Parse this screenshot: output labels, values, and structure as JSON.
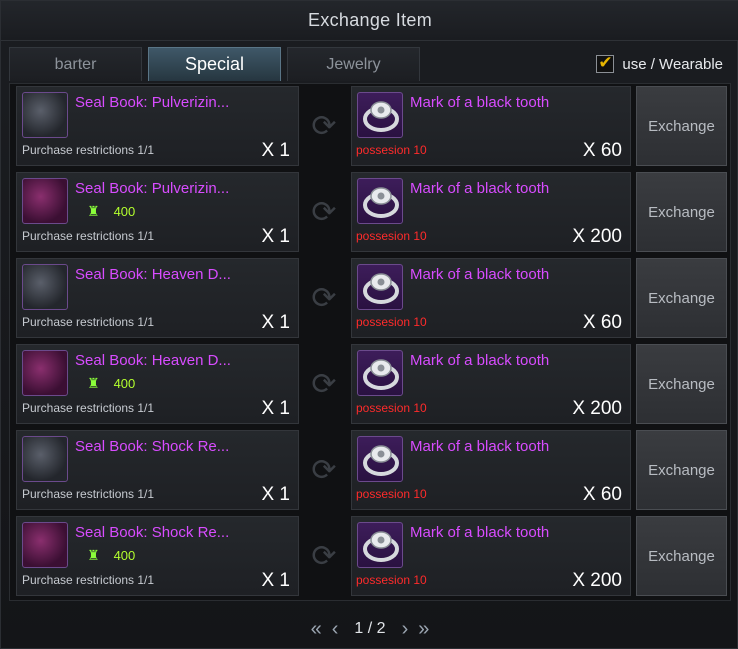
{
  "window": {
    "title": "Exchange Item"
  },
  "tabs": [
    {
      "label": "barter",
      "active": false
    },
    {
      "label": "Special",
      "active": true
    },
    {
      "label": "Jewelry",
      "active": false
    }
  ],
  "filter": {
    "label": "use / Wearable",
    "checked": true
  },
  "exchange_label": "Exchange",
  "rows": [
    {
      "item_name": "Seal Book: Pulverizin...",
      "item_color": "grey",
      "price": "",
      "restriction": "Purchase restrictions 1/1",
      "qty": "X 1",
      "req_name": "Mark of a black tooth",
      "possession": "possesion 10",
      "req_qty": "X 60"
    },
    {
      "item_name": "Seal Book: Pulverizin...",
      "item_color": "purple",
      "price": "400",
      "restriction": "Purchase restrictions 1/1",
      "qty": "X 1",
      "req_name": "Mark of a black tooth",
      "possession": "possesion 10",
      "req_qty": "X 200"
    },
    {
      "item_name": "Seal Book: Heaven D...",
      "item_color": "grey",
      "price": "",
      "restriction": "Purchase restrictions 1/1",
      "qty": "X 1",
      "req_name": "Mark of a black tooth",
      "possession": "possesion 10",
      "req_qty": "X 60"
    },
    {
      "item_name": "Seal Book: Heaven D...",
      "item_color": "purple",
      "price": "400",
      "restriction": "Purchase restrictions 1/1",
      "qty": "X 1",
      "req_name": "Mark of a black tooth",
      "possession": "possesion 10",
      "req_qty": "X 200"
    },
    {
      "item_name": "Seal Book: Shock Re...",
      "item_color": "grey",
      "price": "",
      "restriction": "Purchase restrictions 1/1",
      "qty": "X 1",
      "req_name": "Mark of a black tooth",
      "possession": "possesion 10",
      "req_qty": "X 60"
    },
    {
      "item_name": "Seal Book: Shock Re...",
      "item_color": "purple",
      "price": "400",
      "restriction": "Purchase restrictions 1/1",
      "qty": "X 1",
      "req_name": "Mark of a black tooth",
      "possession": "possesion 10",
      "req_qty": "X 200"
    }
  ],
  "pager": {
    "text": "1 / 2"
  },
  "colors": {
    "accent": "#d84cff",
    "warning": "#ff2b2b",
    "currency": "#b3ff2e"
  }
}
